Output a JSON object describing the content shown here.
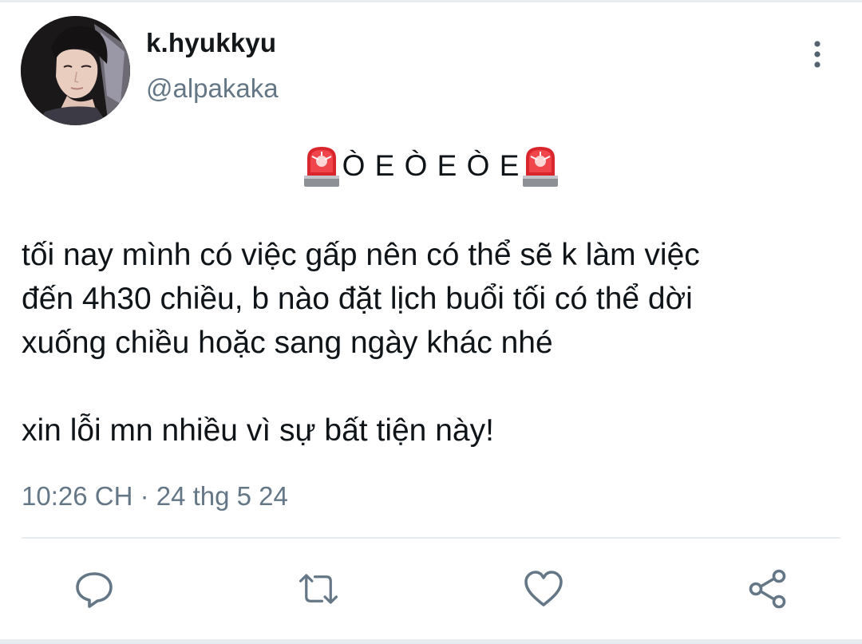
{
  "user": {
    "display_name": "k.hyukkyu",
    "handle": "@alpakaka"
  },
  "tweet": {
    "alert_text": "Ò E Ò E Ò E",
    "alert_emoji": "police-car-light",
    "lines": [
      "tối nay mình có việc gấp nên có thể sẽ k làm việc",
      "đến 4h30 chiều, b nào đặt lịch buổi tối có thể dời",
      "xuống chiều hoặc sang ngày khác nhé",
      "",
      "xin lỗi mn nhiều vì sự bất tiện này!"
    ],
    "timestamp": "10:26 CH · 24 thg 5 24"
  },
  "actions": {
    "reply_icon": "reply-icon",
    "retweet_icon": "retweet-icon",
    "like_icon": "like-icon",
    "share_icon": "share-icon"
  },
  "colors": {
    "text": "#0f1419",
    "secondary": "#657786",
    "divider": "#e6ecf0",
    "siren_red": "#e0282e"
  }
}
